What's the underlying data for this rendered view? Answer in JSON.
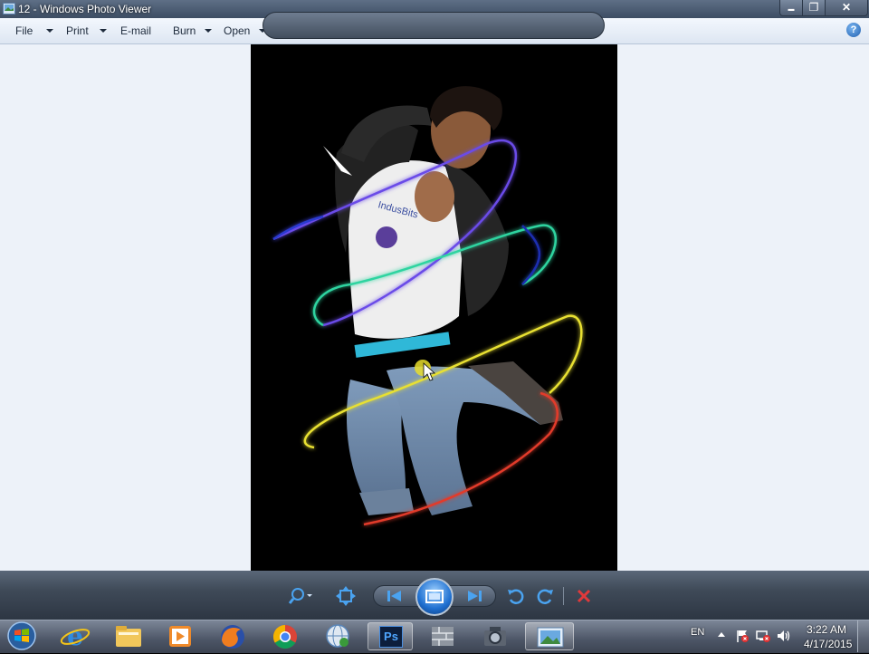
{
  "window": {
    "title": "12 - Windows Photo Viewer",
    "controls": {
      "minimize": "▬",
      "maximize": "❐",
      "close": "✕"
    }
  },
  "menubar": {
    "items": [
      {
        "label": "File",
        "dropdown": true
      },
      {
        "label": "Print",
        "dropdown": true
      },
      {
        "label": "E-mail",
        "dropdown": false
      },
      {
        "label": "Burn",
        "dropdown": true
      },
      {
        "label": "Open",
        "dropdown": true
      }
    ],
    "help_label": "?"
  },
  "viewer": {
    "background": "#edf2f9",
    "photo_background": "#000000"
  },
  "controlbar": {
    "buttons": [
      "zoom-icon",
      "actual-size-icon",
      "previous-icon",
      "slideshow-icon",
      "next-icon",
      "rotate-counterclockwise-icon",
      "rotate-clockwise-icon",
      "delete-icon"
    ],
    "accent": "#3a8fe0",
    "delete_color": "#e0393b"
  },
  "taskbar": {
    "start_icon": "windows-start-icon",
    "pinned": [
      "internet-explorer-icon",
      "file-explorer-icon",
      "media-player-icon",
      "firefox-icon",
      "chrome-icon",
      "network-icon",
      "photoshop-icon",
      "stack-icon",
      "camera-icon",
      "photo-viewer-icon"
    ],
    "photoshop_label": "Ps",
    "tray": {
      "language": "EN",
      "time": "3:22 AM",
      "date": "4/17/2015"
    }
  }
}
